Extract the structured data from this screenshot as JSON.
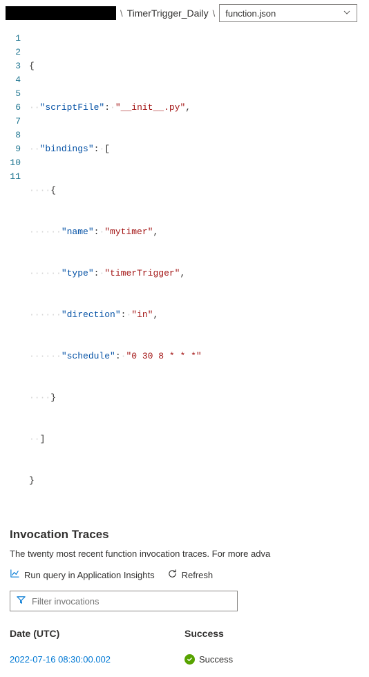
{
  "breadcrumb": {
    "item1": "TimerTrigger_Daily",
    "file_selected": "function.json"
  },
  "code": {
    "line_count": 11,
    "l1": "{",
    "l2_key": "\"scriptFile\"",
    "l2_val": "\"__init__.py\"",
    "l3_key": "\"bindings\"",
    "l5_key": "\"name\"",
    "l5_val": "\"mytimer\"",
    "l6_key": "\"type\"",
    "l6_val": "\"timerTrigger\"",
    "l7_key": "\"direction\"",
    "l7_val": "\"in\"",
    "l8_key": "\"schedule\"",
    "l8_val": "\"0 30 8 * * *\"",
    "l11": "}"
  },
  "traces": {
    "heading": "Invocation Traces",
    "subtext": "The twenty most recent function invocation traces. For more adva",
    "action_query": "Run query in Application Insights",
    "action_refresh": "Refresh",
    "filter_placeholder": "Filter invocations",
    "col_date": "Date (UTC)",
    "col_success": "Success",
    "rows": {
      "r0_date": "2022-07-16 08:30:00.002",
      "r0_status": "Success"
    }
  }
}
